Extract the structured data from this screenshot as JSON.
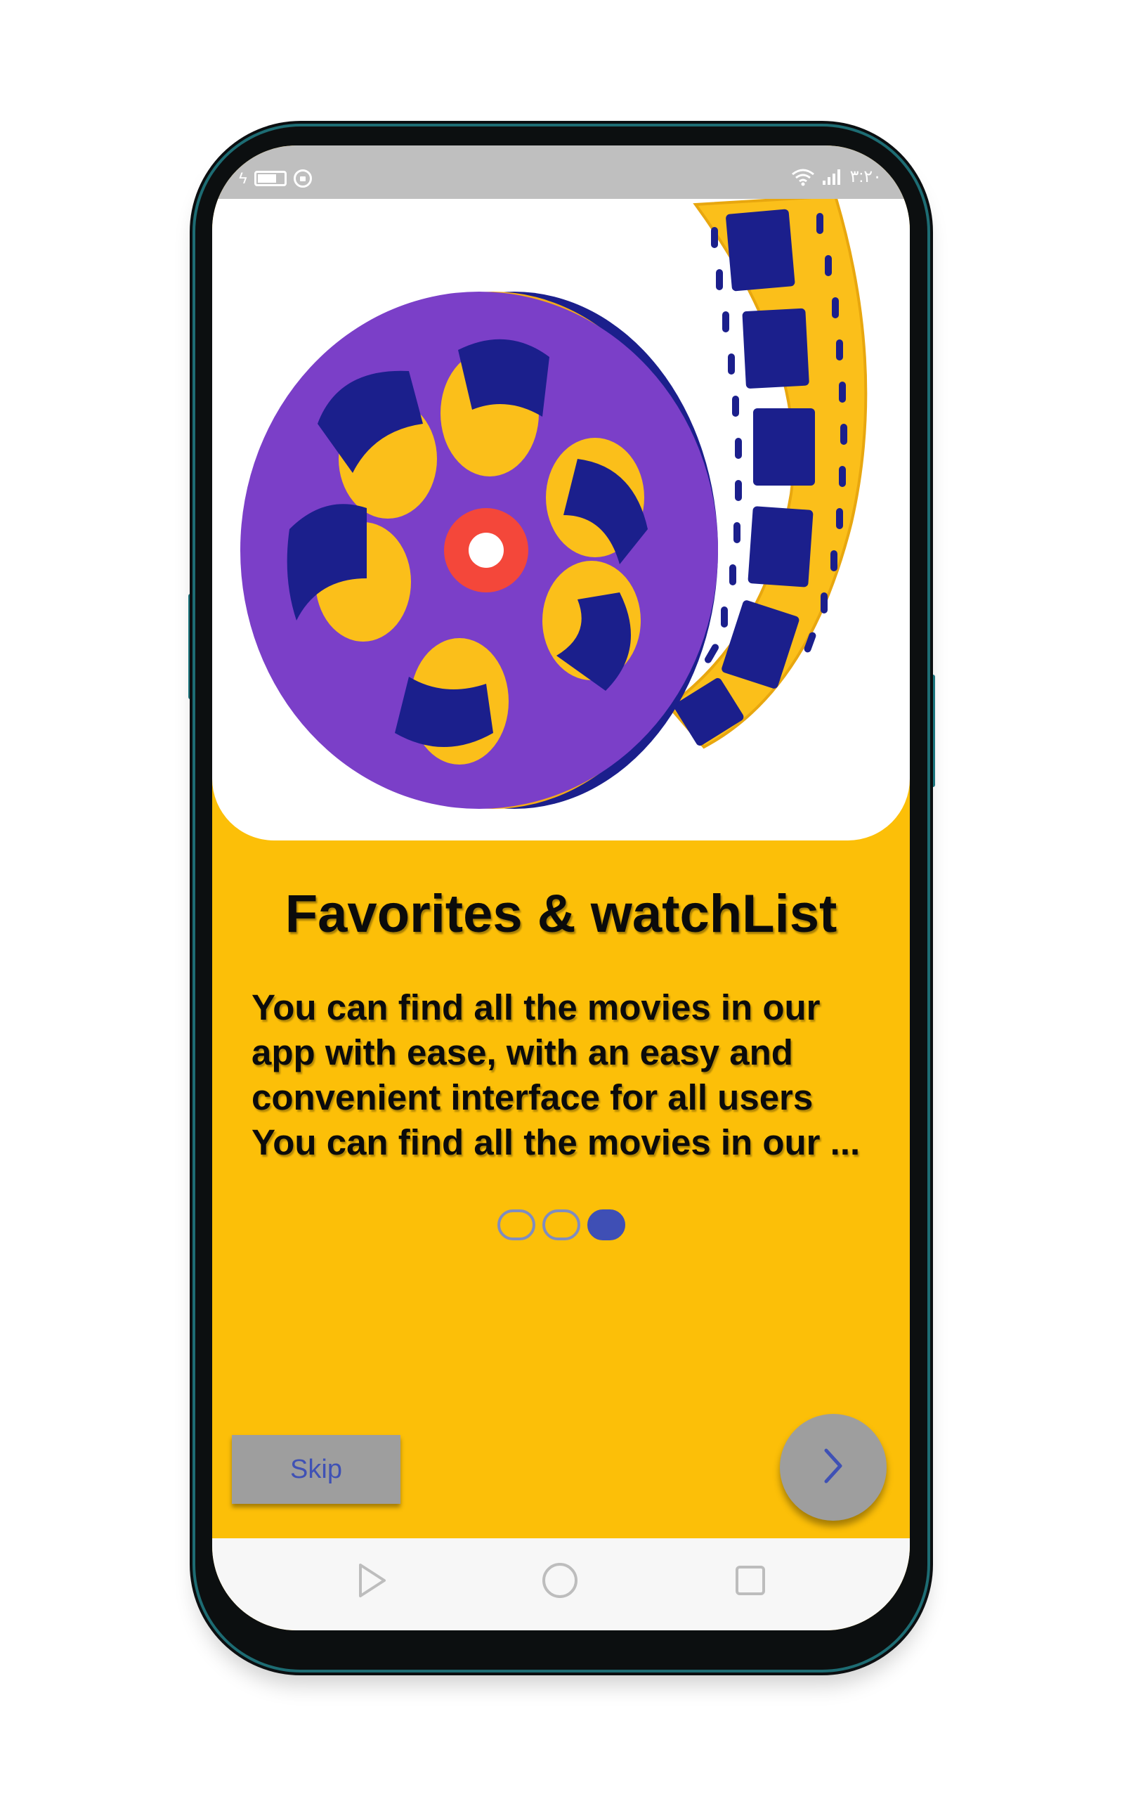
{
  "status_bar": {
    "charge_indicator": "ϟ",
    "time": "٣:٢٠",
    "icons": [
      "charging-icon",
      "battery-icon",
      "lock-icon",
      "wifi-icon",
      "signal-icon"
    ]
  },
  "hero": {
    "illustration": "film-reel-icon",
    "colors": {
      "reel": "#7b3fc8",
      "holes": "#1b1f8c",
      "film": "#fbbf1a",
      "hub": "#f4473a"
    }
  },
  "onboarding": {
    "title": "Favorites & watchList",
    "description_lines": [
      "You can find all the movies in our",
      "app with ease, with an easy and",
      "convenient interface for all users",
      "You can find all the movies in our ..."
    ],
    "page_indicator": {
      "total": 3,
      "active_index": 2
    }
  },
  "actions": {
    "skip_label": "Skip",
    "next_icon": "chevron-right-icon"
  },
  "nav_bar": {
    "icons": [
      "back-triangle-icon",
      "home-circle-icon",
      "recents-square-icon"
    ]
  },
  "colors": {
    "background": "#fcbf08",
    "accent": "#3f51b5",
    "button_gray": "#9e9e9e",
    "status_bar": "#bfbfbf"
  }
}
